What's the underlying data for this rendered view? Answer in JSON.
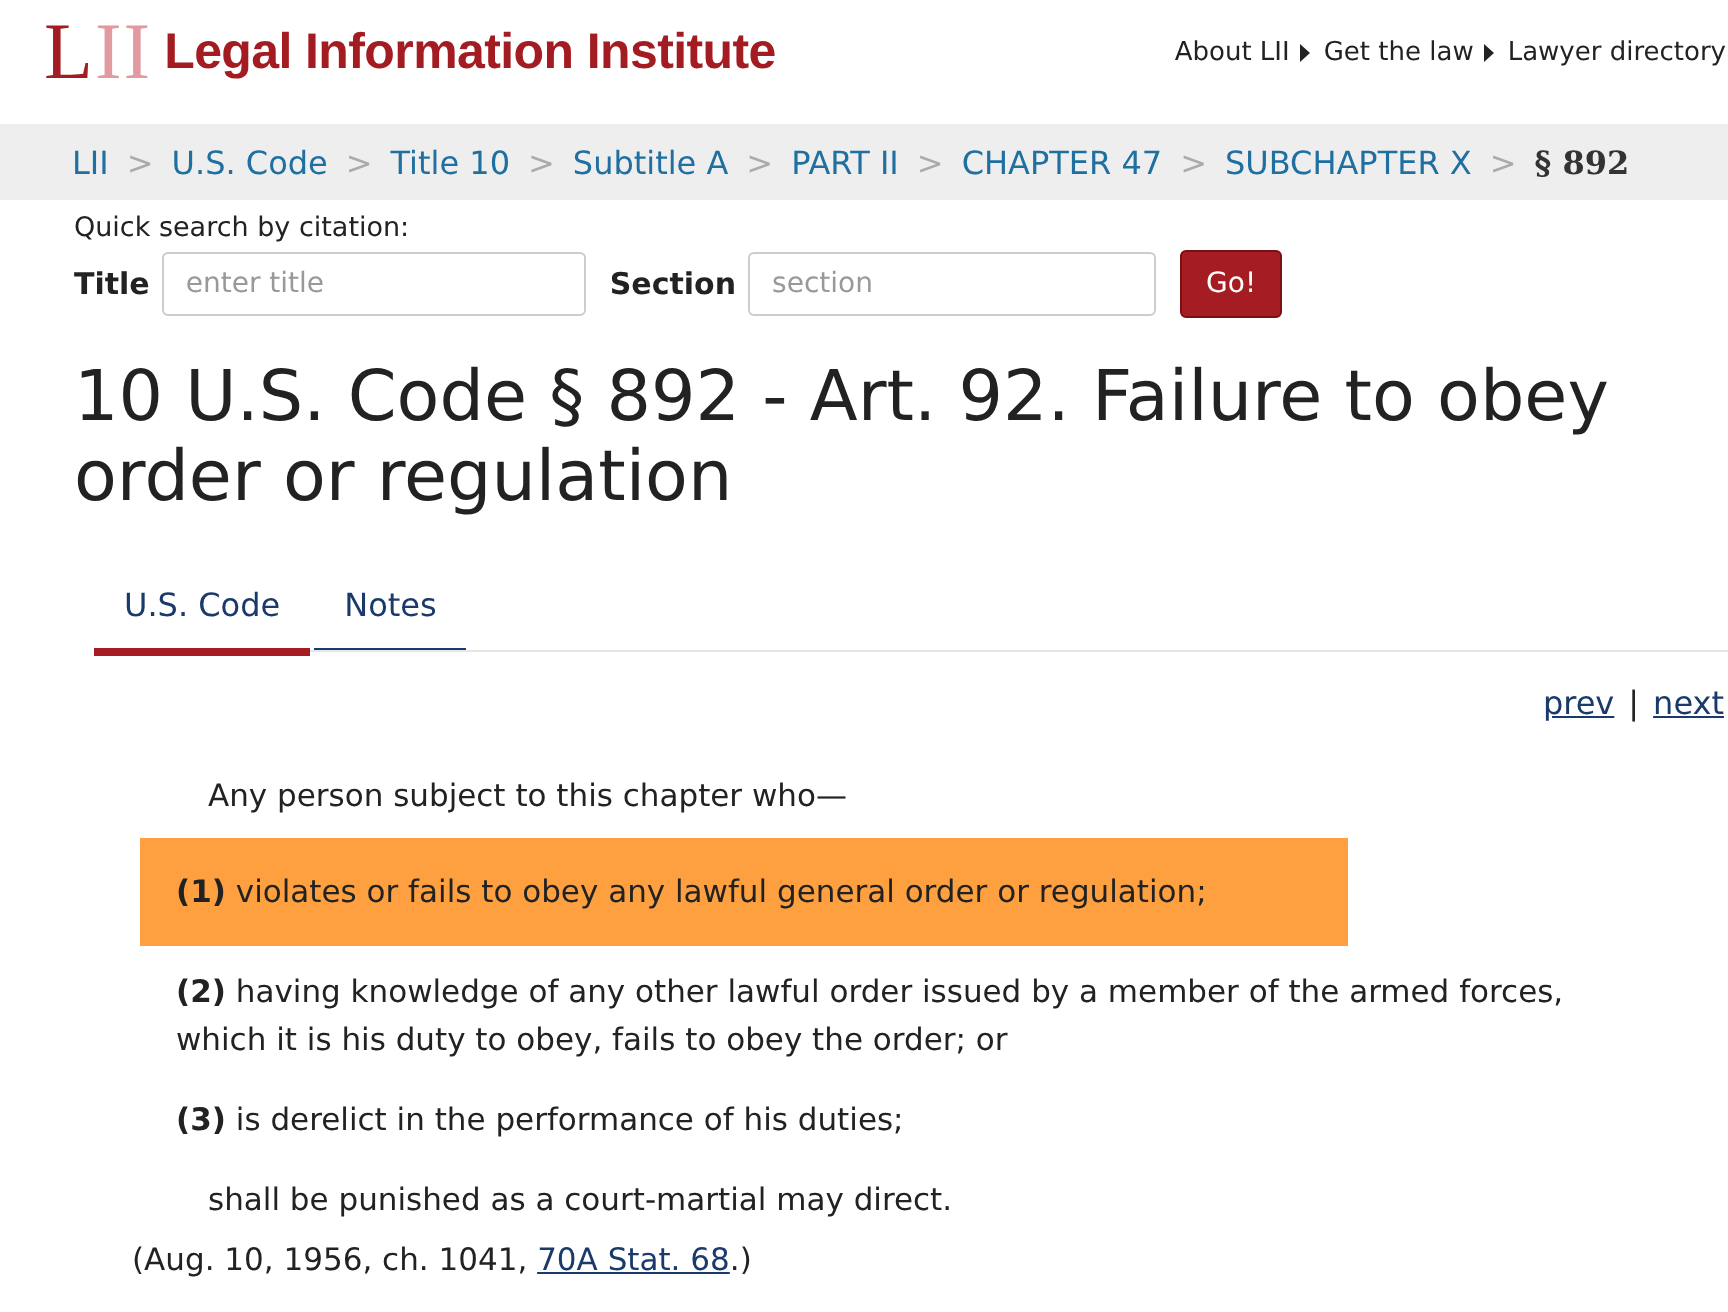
{
  "header": {
    "logo_mark": "LII",
    "logo_text": "Legal Information Institute",
    "nav": [
      "About LII",
      "Get the law",
      "Lawyer directory"
    ]
  },
  "breadcrumb_separator": ">",
  "breadcrumb": [
    {
      "label": "LII",
      "current": false
    },
    {
      "label": "U.S. Code",
      "current": false
    },
    {
      "label": "Title 10",
      "current": false
    },
    {
      "label": "Subtitle A",
      "current": false
    },
    {
      "label": "PART II",
      "current": false
    },
    {
      "label": "CHAPTER 47",
      "current": false
    },
    {
      "label": "SUBCHAPTER X",
      "current": false
    },
    {
      "label": "§ 892",
      "current": true
    }
  ],
  "quick_search": {
    "caption": "Quick search by citation:",
    "title_label": "Title",
    "title_placeholder": "enter title",
    "section_label": "Section",
    "section_placeholder": "section",
    "button": "Go!"
  },
  "heading": "10 U.S. Code § 892 - Art. 92. Failure to obey order or regulation",
  "tabs": [
    {
      "label": "U.S. Code",
      "selected": true
    },
    {
      "label": "Notes",
      "selected": false
    }
  ],
  "pager": {
    "prev": "prev",
    "separator": "|",
    "next": "next"
  },
  "body": {
    "intro": "Any person subject to this chapter who—",
    "items": [
      {
        "number": "(1)",
        "text": "violates or fails to obey any lawful general order or regulation;",
        "highlighted": true
      },
      {
        "number": "(2)",
        "text": "having knowledge of any other lawful order issued by a member of the armed forces, which it is his duty to obey, fails to obey the order; or",
        "highlighted": false
      },
      {
        "number": "(3)",
        "text": "is derelict in the performance of his duties;",
        "highlighted": false
      }
    ],
    "closing": "shall be punished as a court-martial may direct.",
    "citation_before": "(Aug. 10, 1956, ch. 1041,",
    "citation_link": "70A Stat. 68",
    "citation_after": ".)"
  }
}
